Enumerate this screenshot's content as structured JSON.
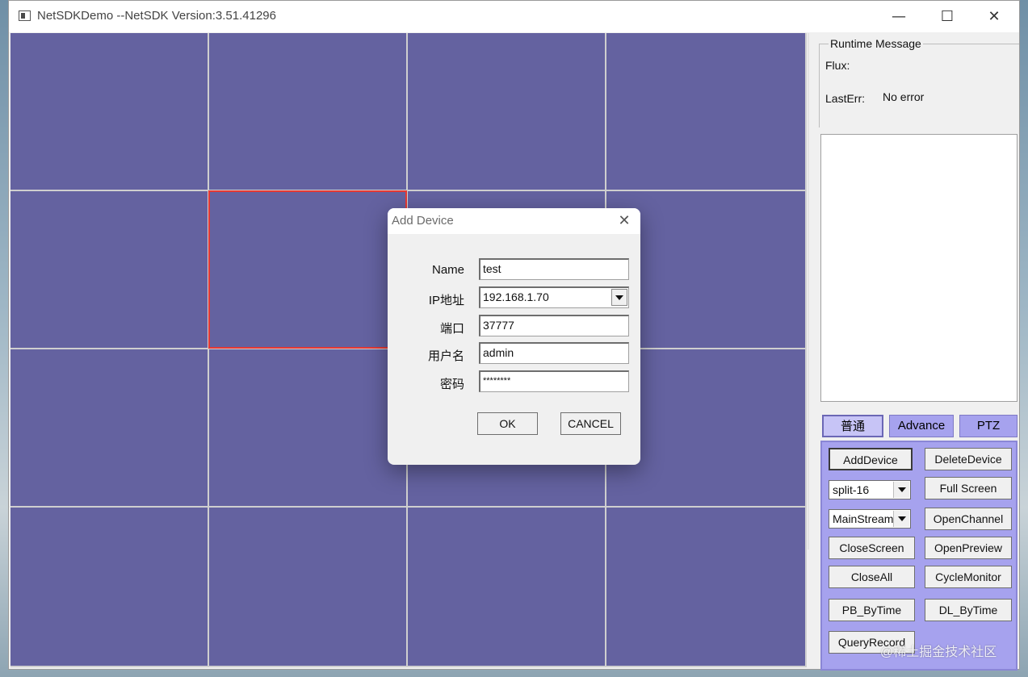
{
  "window": {
    "title": "NetSDKDemo  --NetSDK Version:3.51.41296"
  },
  "title_buttons": {
    "minimize": "—",
    "maximize": "☐",
    "close": "✕"
  },
  "runtime": {
    "group_title": "Runtime Message",
    "flux_label": "Flux:",
    "flux_value": "",
    "lasterr_label": "LastErr:",
    "lasterr_value": "No error"
  },
  "tabs": [
    "普通",
    "Advance",
    "PTZ"
  ],
  "panel": {
    "add_device": "AddDevice",
    "delete_device": "DeleteDevice",
    "split_select": "split-16",
    "full_screen": "Full Screen",
    "stream_select": "MainStream",
    "open_channel": "OpenChannel",
    "close_screen": "CloseScreen",
    "open_preview": "OpenPreview",
    "close_all": "CloseAll",
    "cycle_monitor": "CycleMonitor",
    "pb_bytime": "PB_ByTime",
    "dl_bytime": "DL_ByTime",
    "query_record": "QueryRecord"
  },
  "dialog": {
    "title": "Add Device",
    "close": "✕",
    "name_label": "Name",
    "name_value": "test",
    "ip_label": "IP地址",
    "ip_value": "192.168.1.70",
    "port_label": "端口",
    "port_value": "37777",
    "user_label": "用户名",
    "user_value": "admin",
    "password_label": "密码",
    "password_value": "********",
    "ok": "OK",
    "cancel": "CANCEL"
  },
  "watermark": "@稀土掘金技术社区",
  "colors": {
    "video_cell": "#6462a0",
    "selected_border": "#e53935",
    "panel_purple": "#a6a2ee"
  }
}
